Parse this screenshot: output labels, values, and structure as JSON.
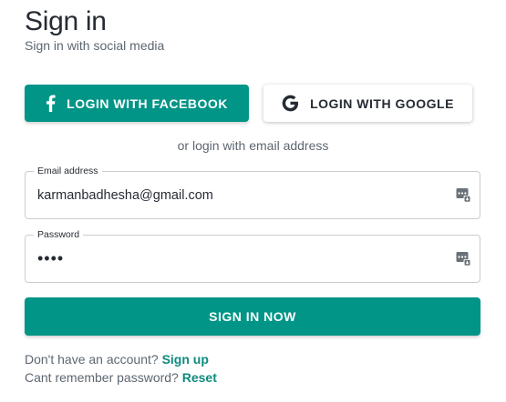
{
  "header": {
    "title": "Sign in",
    "subtitle": "Sign in with social media"
  },
  "social": {
    "facebook_label": "LOGIN WITH FACEBOOK",
    "google_label": "LOGIN WITH GOOGLE",
    "facebook_icon": "facebook-icon",
    "google_icon": "google-icon"
  },
  "divider_text": "or login with email address",
  "form": {
    "email": {
      "label": "Email address",
      "value": "karmanbadhesha@gmail.com",
      "icon": "password-manager-icon"
    },
    "password": {
      "label": "Password",
      "value": "••••",
      "icon": "password-manager-icon"
    },
    "submit_label": "SIGN IN NOW"
  },
  "footer": {
    "signup_prompt": "Don't have an account?",
    "signup_link": "Sign up",
    "reset_prompt": "Cant remember password?",
    "reset_link": "Reset"
  },
  "colors": {
    "accent": "#009587",
    "link": "#0e8a7d",
    "text": "#262b33",
    "muted": "#5d6670",
    "border": "#c9cdd2"
  }
}
